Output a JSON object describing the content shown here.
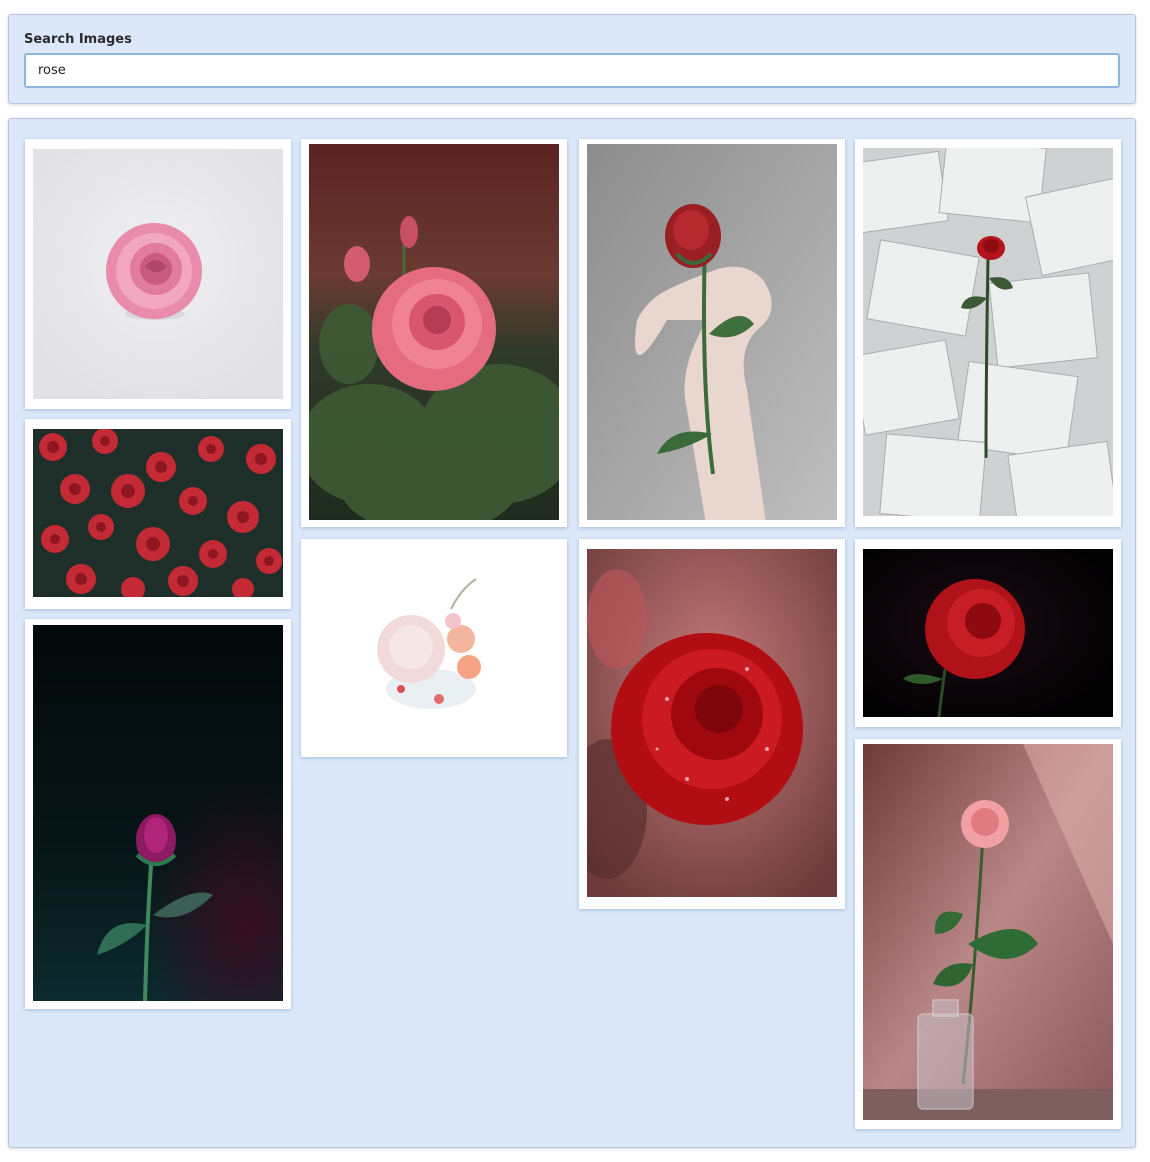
{
  "search": {
    "label": "Search Images",
    "value": "rose"
  },
  "results": [
    {
      "id": 1,
      "subject": "pink-rose-white-background-icon"
    },
    {
      "id": 2,
      "subject": "red-roses-field-icon"
    },
    {
      "id": 3,
      "subject": "purple-rose-dark-icon"
    },
    {
      "id": 4,
      "subject": "pink-rose-bush-icon"
    },
    {
      "id": 5,
      "subject": "white-bouquet-icon"
    },
    {
      "id": 6,
      "subject": "hand-holding-rose-icon"
    },
    {
      "id": 7,
      "subject": "red-rose-droplets-icon"
    },
    {
      "id": 8,
      "subject": "rose-on-book-pages-icon"
    },
    {
      "id": 9,
      "subject": "red-rose-black-icon"
    },
    {
      "id": 10,
      "subject": "rose-in-vase-icon"
    }
  ]
}
